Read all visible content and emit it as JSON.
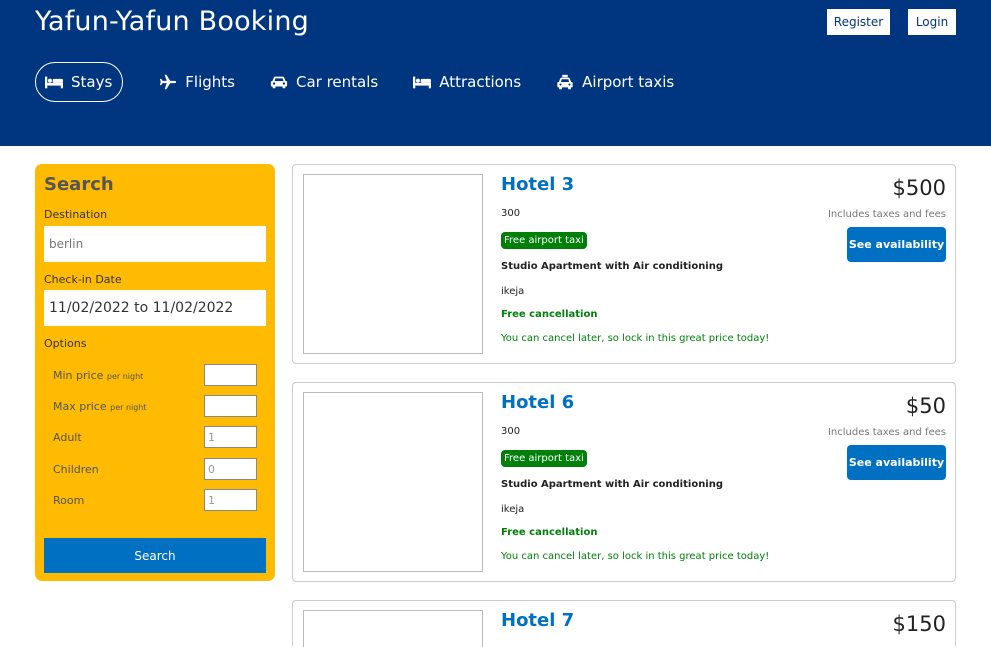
{
  "header": {
    "brand": "Yafun-Yafun Booking",
    "register_label": "Register",
    "login_label": "Login",
    "nav": [
      {
        "label": "Stays",
        "icon": "bed-icon",
        "active": true
      },
      {
        "label": "Flights",
        "icon": "plane-icon"
      },
      {
        "label": "Car rentals",
        "icon": "car-icon"
      },
      {
        "label": "Attractions",
        "icon": "bed-icon"
      },
      {
        "label": "Airport taxis",
        "icon": "taxi-icon"
      }
    ]
  },
  "search": {
    "title": "Search",
    "destination_label": "Destination",
    "destination_placeholder": "berlin",
    "checkin_label": "Check-in Date",
    "checkin_value": "11/02/2022 to 11/02/2022",
    "options_label": "Options",
    "options": [
      {
        "label": "Min price",
        "suffix": "per night",
        "value": ""
      },
      {
        "label": "Max price",
        "suffix": "per night",
        "value": ""
      },
      {
        "label": "Adult",
        "suffix": "",
        "value": "1"
      },
      {
        "label": "Children",
        "suffix": "",
        "value": "0"
      },
      {
        "label": "Room",
        "suffix": "",
        "value": "1"
      }
    ],
    "button_label": "Search"
  },
  "results": [
    {
      "name": "Hotel 3",
      "distance": "300",
      "taxi": "Free airport taxi",
      "subtitle": "Studio Apartment with Air conditioning",
      "location": "ikeja",
      "cancel": "Free cancellation",
      "cancel_sub": "You can cancel later, so lock in this great price today!",
      "price": "$500",
      "taxes": "Includes taxes and fees",
      "button": "See availability"
    },
    {
      "name": "Hotel 6",
      "distance": "300",
      "taxi": "Free airport taxi",
      "subtitle": "Studio Apartment with Air conditioning",
      "location": "ikeja",
      "cancel": "Free cancellation",
      "cancel_sub": "You can cancel later, so lock in this great price today!",
      "price": "$50",
      "taxes": "Includes taxes and fees",
      "button": "See availability"
    },
    {
      "name": "Hotel 7",
      "price": "$150"
    }
  ],
  "colors": {
    "header_bg": "#003580",
    "search_bg": "#febb02",
    "primary": "#0071c2",
    "success": "#008009"
  }
}
